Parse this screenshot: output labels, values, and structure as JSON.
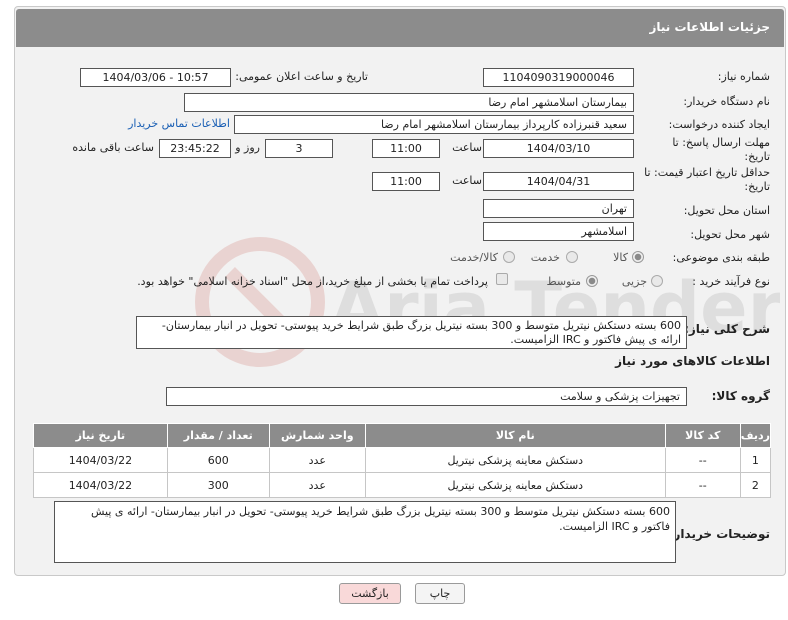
{
  "header": {
    "title": "جزئیات اطلاعات نیاز"
  },
  "fields": {
    "need_number": {
      "label": "شماره نیاز:",
      "value": "1104090319000046"
    },
    "announce_datetime": {
      "label": "تاریخ و ساعت اعلان عمومی:",
      "value": "1404/03/06 - 10:57"
    },
    "buyer_org": {
      "label": "نام دستگاه خریدار:",
      "value": "بیمارستان اسلامشهر   امام رضا"
    },
    "requester": {
      "label": "ایجاد کننده درخواست:",
      "value": "سعید قنبرزاده کارپرداز بیمارستان اسلامشهر   امام رضا",
      "contact_link": "اطلاعات تماس خریدار"
    },
    "reply_deadline": {
      "label": "مهلت ارسال پاسخ: تا تاریخ:",
      "date": "1404/03/10",
      "time_label": "ساعت",
      "time": "11:00",
      "days": "3",
      "days_label": "روز و",
      "remaining": "23:45:22",
      "remaining_label": "ساعت باقی مانده"
    },
    "price_validity": {
      "label": "حداقل تاریخ اعتبار قیمت: تا تاریخ:",
      "date": "1404/04/31",
      "time_label": "ساعت",
      "time": "11:00"
    },
    "province": {
      "label": "استان محل تحویل:",
      "value": "تهران"
    },
    "city": {
      "label": "شهر محل تحویل:",
      "value": "اسلامشهر"
    },
    "category": {
      "label": "طبقه بندی موضوعی:",
      "options": [
        "کالا",
        "خدمت",
        "کالا/خدمت"
      ]
    },
    "process": {
      "label": "نوع فرآیند خرید :",
      "options": [
        "جزیی",
        "متوسط"
      ],
      "payment_note": "پرداخت تمام یا بخشی از مبلغ خرید،از محل \"اسناد خزانه اسلامی\" خواهد بود."
    },
    "description": {
      "label": "شرح کلی نیاز:",
      "value": "600 بسته دستکش نیتریل متوسط و 300 بسته نیتریل بزرگ طبق شرایط خرید پیوستی- تحویل در انبار بیمارستان- ارائه ی پیش فاکتور و IRC الزامیست."
    }
  },
  "goods_section": {
    "title": "اطلاعات کالاهای مورد نیاز",
    "group_label": "گروه کالا:",
    "group_value": "تجهیزات پزشکی و سلامت"
  },
  "table": {
    "headers": [
      "ردیف",
      "کد کالا",
      "نام کالا",
      "واحد شمارش",
      "تعداد / مقدار",
      "تاریخ نیاز"
    ],
    "rows": [
      [
        "1",
        "--",
        "دستکش معاینه پزشکی نیتریل",
        "عدد",
        "600",
        "1404/03/22"
      ],
      [
        "2",
        "--",
        "دستکش معاینه پزشکی نیتریل",
        "عدد",
        "300",
        "1404/03/22"
      ]
    ]
  },
  "buyer_notes": {
    "label": "توضیحات خریدار:",
    "value": "600 بسته دستکش نیتریل متوسط و 300 بسته نیتریل بزرگ طبق شرایط خرید پیوستی- تحویل در انبار بیمارستان- ارائه ی پیش فاکتور و IRC الزامیست."
  },
  "buttons": {
    "print": "چاپ",
    "back": "بازگشت"
  },
  "colors": {
    "header_bg": "#8c8c8c",
    "link": "#1a5fb4",
    "back_button_bg": "#f9d9d9"
  }
}
